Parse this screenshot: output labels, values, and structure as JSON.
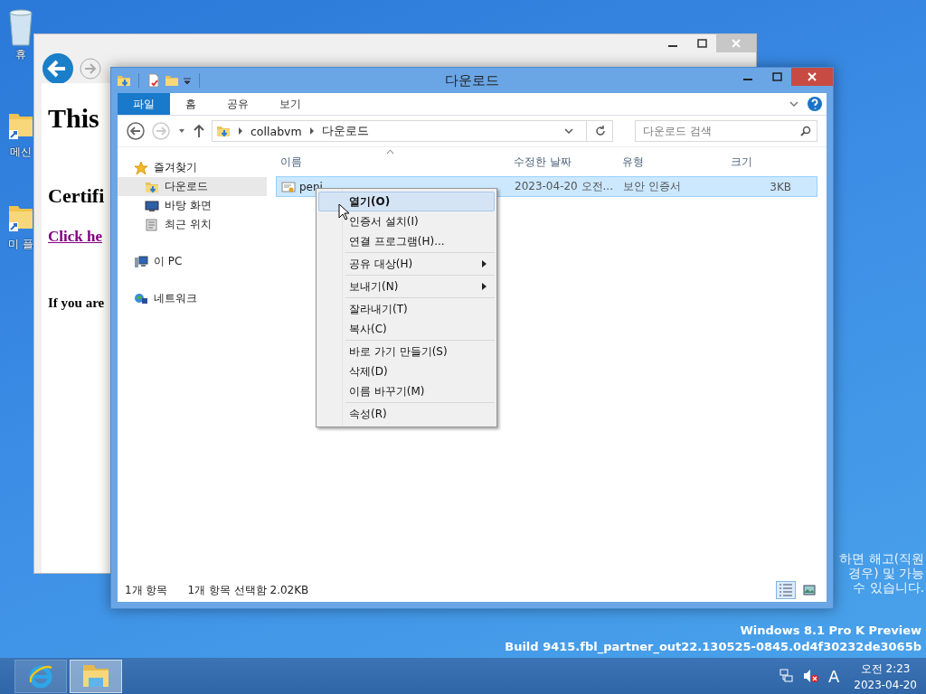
{
  "desktop_icons": [
    {
      "label": "휴"
    },
    {
      "label": "메신"
    },
    {
      "label": "미 플"
    }
  ],
  "browser": {
    "headings": [
      {
        "text": "This",
        "kind": "h1"
      },
      {
        "text": "Certifi",
        "kind": "h2"
      },
      {
        "text": "Click he",
        "kind": "link"
      },
      {
        "text": "If you are",
        "kind": "p"
      }
    ]
  },
  "explorer": {
    "title": "다운로드",
    "ribbon_tabs": [
      {
        "label": "파일",
        "selected": true
      },
      {
        "label": "홈",
        "selected": false
      },
      {
        "label": "공유",
        "selected": false
      },
      {
        "label": "보기",
        "selected": false
      }
    ],
    "breadcrumb": [
      "collabvm",
      "다운로드"
    ],
    "search": {
      "placeholder": "다운로드 검색"
    },
    "nav": [
      {
        "label": "즐겨찾기",
        "selected": false,
        "children": [
          {
            "label": "다운로드",
            "selected": true
          },
          {
            "label": "바탕 화면",
            "selected": false
          },
          {
            "label": "최근 위치",
            "selected": false
          }
        ]
      },
      {
        "label": "이 PC",
        "selected": false
      },
      {
        "label": "네트워크",
        "selected": false
      }
    ],
    "columns": [
      "이름",
      "수정한 날짜",
      "유형",
      "크기"
    ],
    "rows": [
      {
        "name": "peni",
        "date": "2023-04-20 오전...",
        "type": "보안 인증서",
        "size": "3KB",
        "selected": true
      }
    ],
    "status": [
      "1개 항목",
      "1개 항목 선택함 2.02KB"
    ],
    "views": [
      {
        "kind": "details",
        "selected": true
      },
      {
        "kind": "thumbnails",
        "selected": false
      }
    ]
  },
  "context_menu": [
    [
      {
        "label": "열기(O)",
        "selected": true,
        "default": true,
        "submenu": false
      },
      {
        "label": "인증서 설치(I)",
        "selected": false,
        "default": false,
        "submenu": false
      },
      {
        "label": "연결 프로그램(H)...",
        "selected": false,
        "default": false,
        "submenu": false
      }
    ],
    [
      {
        "label": "공유 대상(H)",
        "selected": false,
        "default": false,
        "submenu": true
      }
    ],
    [
      {
        "label": "보내기(N)",
        "selected": false,
        "default": false,
        "submenu": true
      }
    ],
    [
      {
        "label": "잘라내기(T)",
        "selected": false,
        "default": false,
        "submenu": false
      },
      {
        "label": "복사(C)",
        "selected": false,
        "default": false,
        "submenu": false
      }
    ],
    [
      {
        "label": "바로 가기 만들기(S)",
        "selected": false,
        "default": false,
        "submenu": false
      },
      {
        "label": "삭제(D)",
        "selected": false,
        "default": false,
        "submenu": false
      },
      {
        "label": "이름 바꾸기(M)",
        "selected": false,
        "default": false,
        "submenu": false
      }
    ],
    [
      {
        "label": "속성(R)",
        "selected": false,
        "default": false,
        "submenu": false
      }
    ]
  ],
  "desktop_notice": [
    "하면 해고(직원",
    "경우) 및 가능",
    "수 있습니다."
  ],
  "watermark": [
    "Windows 8.1 Pro K Preview",
    "Build 9415.fbl_partner_out22.130525-0845.0d4f30232de3065b"
  ],
  "taskbar": {
    "apps": [
      {
        "kind": "ie",
        "selected": false
      },
      {
        "kind": "explorer",
        "selected": true
      }
    ],
    "ime": "A",
    "time": "오전 2:23",
    "date": "2023-04-20"
  }
}
